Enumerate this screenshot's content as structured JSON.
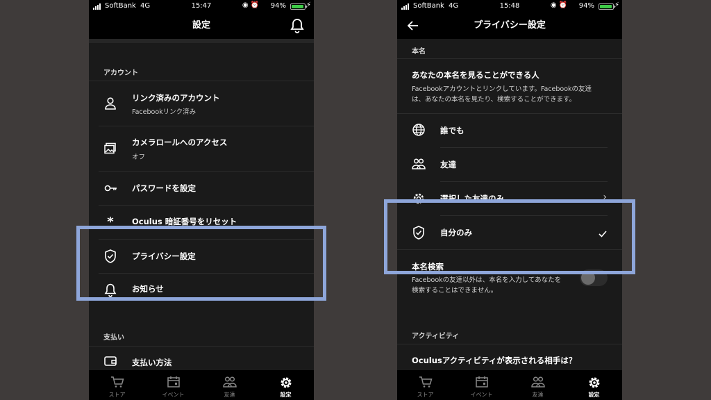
{
  "left": {
    "status": {
      "carrier": "SoftBank",
      "network": "4G",
      "time": "15:47",
      "battery": "94%"
    },
    "nav": {
      "title": "設定"
    },
    "sections": {
      "account": "アカウント",
      "payment": "支払い"
    },
    "rows": {
      "linked": {
        "label": "リンク済みのアカウント",
        "sub": "Facebookリンク済み"
      },
      "camera": {
        "label": "カメラロールへのアクセス",
        "sub": "オフ"
      },
      "password": {
        "label": "パスワードを設定"
      },
      "pin": {
        "label": "Oculus 暗証番号をリセット"
      },
      "privacy": {
        "label": "プライバシー設定"
      },
      "notify": {
        "label": "お知らせ"
      },
      "payment_method": {
        "label": "支払い方法"
      }
    },
    "tabs": [
      "ストア",
      "イベント",
      "友達",
      "設定"
    ],
    "active_tab": "設定"
  },
  "right": {
    "status": {
      "carrier": "SoftBank",
      "network": "4G",
      "time": "15:48",
      "battery": "94%"
    },
    "nav": {
      "title": "プライバシー設定"
    },
    "sections": {
      "real_name": "本名",
      "activity": "アクティビティ"
    },
    "real_name_title": "あなたの本名を見ることができる人",
    "real_name_desc": "Facebookアカウントとリンクしています。Facebookの友達は、あなたの本名を見たり、検索することができます。",
    "options": {
      "everyone": "誰でも",
      "friends": "友達",
      "selected": "選択した友達のみ",
      "only_me": "自分のみ"
    },
    "selected_option": "自分のみ",
    "search": {
      "title": "本名検索",
      "desc": "Facebookの友達以外は、本名を入力してあなたを検索することはできません。",
      "enabled": false
    },
    "activity_title": "Oculusアクティビティが表示される相手は？",
    "tabs": [
      "ストア",
      "イベント",
      "友達",
      "設定"
    ],
    "active_tab": "設定"
  },
  "colors": {
    "highlight": "#8ea6da",
    "battery": "#3ecb47",
    "background": "#3f3b3a"
  }
}
